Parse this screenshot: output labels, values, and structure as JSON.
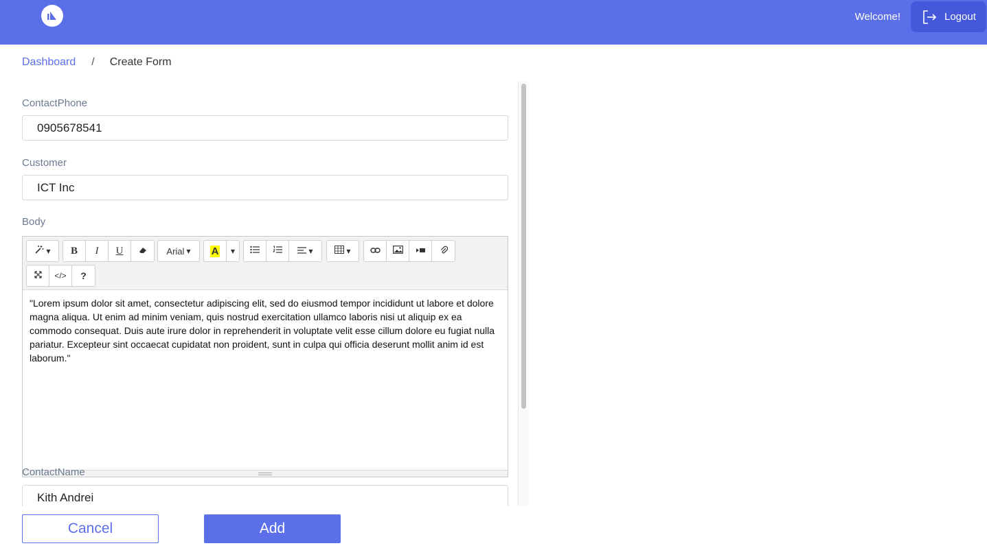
{
  "header": {
    "welcome_text": "Welcome!",
    "logout_label": "Logout",
    "brand_color": "#5b6fe9",
    "logo_icon": "sail-logo-icon"
  },
  "breadcrumb": {
    "root": "Dashboard",
    "separator": "/",
    "current": "Create Form"
  },
  "form": {
    "contact_phone": {
      "label": "ContactPhone",
      "value": "0905678541"
    },
    "customer": {
      "label": "Customer",
      "value": "ICT Inc"
    },
    "body": {
      "label": "Body",
      "toolbar": {
        "style_icon": "magic-wand-icon",
        "bold": "B",
        "italic": "I",
        "underline": "U",
        "eraser_icon": "eraser-icon",
        "font_name": "Arial",
        "color_icon": "text-color-icon",
        "color_letter": "A",
        "ul_icon": "unordered-list-icon",
        "ol_icon": "ordered-list-icon",
        "align_icon": "align-icon",
        "table_icon": "table-icon",
        "link_icon": "link-icon",
        "picture_icon": "picture-icon",
        "video_icon": "video-icon",
        "attach_icon": "paperclip-icon",
        "fullscreen_icon": "fullscreen-icon",
        "codeview": "</>",
        "help": "?"
      },
      "content": "\"Lorem ipsum dolor sit amet, consectetur adipiscing elit, sed do eiusmod tempor incididunt ut labore et dolore magna aliqua. Ut enim ad minim veniam, quis nostrud exercitation ullamco laboris nisi ut aliquip ex ea commodo consequat. Duis aute irure dolor in reprehenderit in voluptate velit esse cillum dolore eu fugiat nulla pariatur. Excepteur sint occaecat cupidatat non proident, sunt in culpa qui officia deserunt mollit anim id est laborum.\""
    },
    "contact_name": {
      "label": "ContactName",
      "value": "Kith Andrei"
    }
  },
  "actions": {
    "cancel_label": "Cancel",
    "add_label": "Add"
  }
}
